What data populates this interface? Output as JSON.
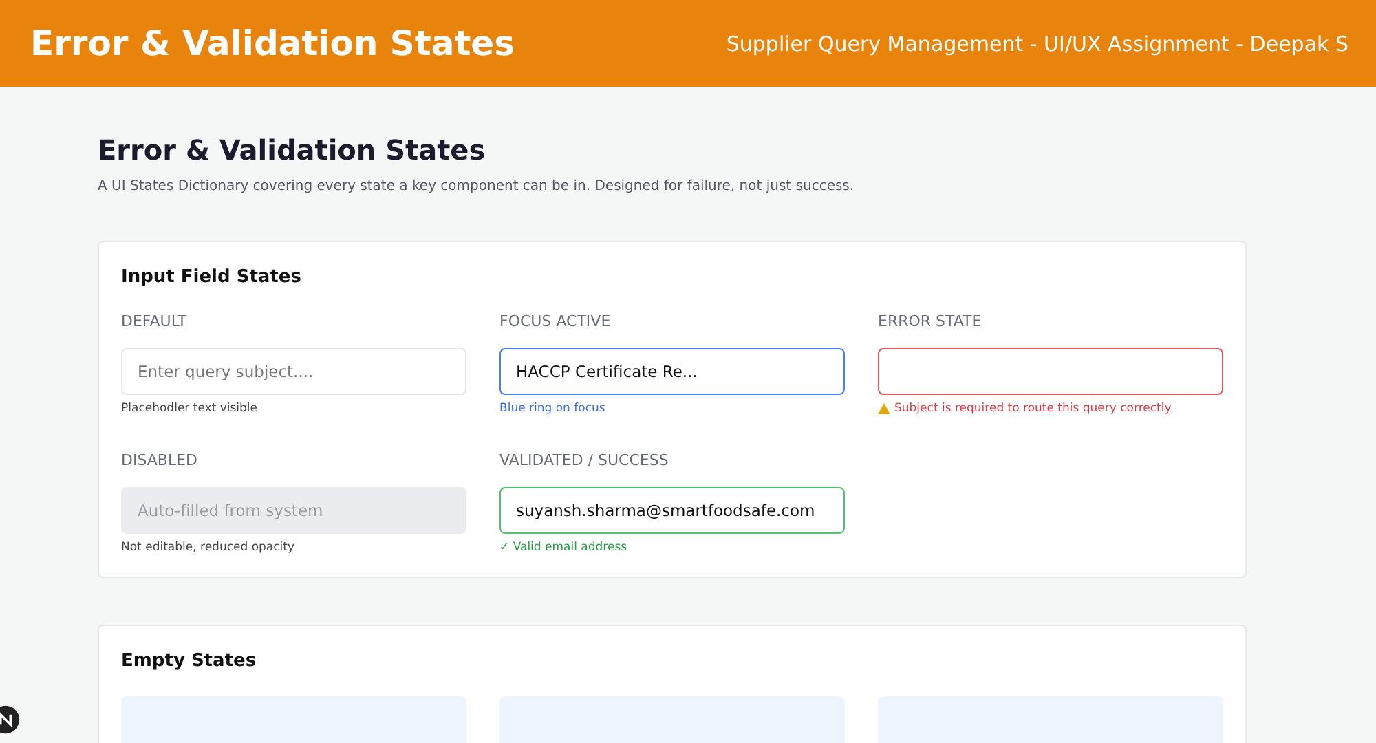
{
  "header": {
    "title": "Error & Validation States",
    "subtitle": "Supplier Query Management - UI/UX Assignment - Deepak S"
  },
  "page": {
    "title": "Error & Validation States",
    "description": "A UI States Dictionary covering every state a key component can be in. Designed for failure, not just success."
  },
  "input_states": {
    "title": "Input Field States",
    "fields": [
      {
        "kind": "default",
        "label": "DEFAULT",
        "placeholder": "Enter query subject....",
        "hint": "Placehodler text visible"
      },
      {
        "kind": "focus",
        "label": "FOCUS ACTIVE",
        "value": "HACCP Certificate Re...",
        "hint": "Blue ring on focus"
      },
      {
        "kind": "error",
        "label": "ERROR STATE",
        "hint": "Subject is required to route this query correctly"
      },
      {
        "kind": "disabled",
        "label": "DISABLED",
        "placeholder": "Auto-filled from system",
        "hint": "Not editable, reduced opacity"
      },
      {
        "kind": "success",
        "label": "VALIDATED / SUCCESS",
        "value": "suyansh.sharma@smartfoodsafe.com",
        "hint": "✓ Valid email address"
      }
    ]
  },
  "empty_states": {
    "title": "Empty States",
    "cards": [
      {
        "kind": "placeholder"
      },
      {
        "kind": "placeholder"
      },
      {
        "kind": "placeholder"
      }
    ]
  }
}
